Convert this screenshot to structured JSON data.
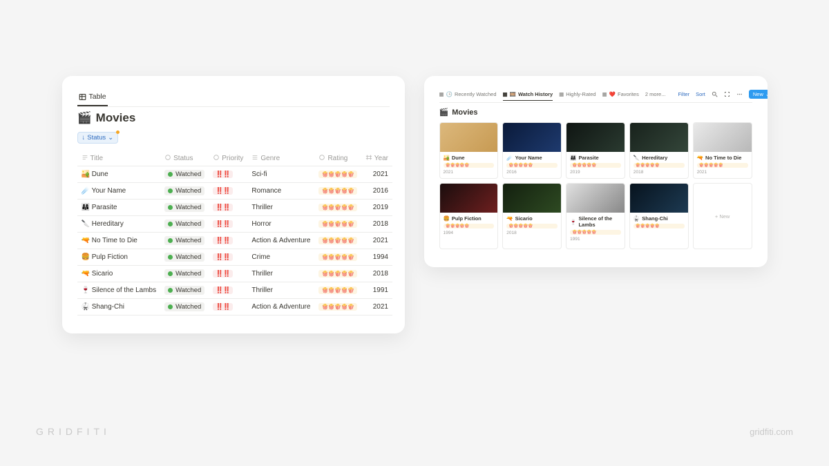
{
  "branding": {
    "logo_text": "GRIDFITI",
    "site": "gridfiti.com"
  },
  "left": {
    "view_tab": "Table",
    "title": "Movies",
    "title_emoji": "🎬",
    "filter_chip": {
      "arrow": "↓",
      "label": "Status",
      "chevron": "⌄"
    },
    "columns": {
      "title": "Title",
      "status": "Status",
      "priority": "Priority",
      "genre": "Genre",
      "rating": "Rating",
      "year": "Year"
    },
    "rows": [
      {
        "emoji": "🏜️",
        "title": "Dune",
        "status": "Watched",
        "priority": "‼️‼️",
        "genre": "Sci-fi",
        "rating": "🍿🍿🍿🍿🍿",
        "year": "2021"
      },
      {
        "emoji": "☄️",
        "title": "Your Name",
        "status": "Watched",
        "priority": "‼️‼️",
        "genre": "Romance",
        "rating": "🍿🍿🍿🍿🍿",
        "year": "2016"
      },
      {
        "emoji": "👨‍👩‍👧",
        "title": "Parasite",
        "status": "Watched",
        "priority": "‼️‼️",
        "genre": "Thriller",
        "rating": "🍿🍿🍿🍿🍿",
        "year": "2019"
      },
      {
        "emoji": "🔪",
        "title": "Hereditary",
        "status": "Watched",
        "priority": "‼️‼️",
        "genre": "Horror",
        "rating": "🍿🍿🍿🍿🍿",
        "year": "2018"
      },
      {
        "emoji": "🔫",
        "title": "No Time to Die",
        "status": "Watched",
        "priority": "‼️‼️",
        "genre": "Action & Adventure",
        "rating": "🍿🍿🍿🍿🍿",
        "year": "2021"
      },
      {
        "emoji": "🍔",
        "title": "Pulp Fiction",
        "status": "Watched",
        "priority": "‼️‼️",
        "genre": "Crime",
        "rating": "🍿🍿🍿🍿🍿",
        "year": "1994"
      },
      {
        "emoji": "🔫",
        "title": "Sicario",
        "status": "Watched",
        "priority": "‼️‼️",
        "genre": "Thriller",
        "rating": "🍿🍿🍿🍿🍿",
        "year": "2018"
      },
      {
        "emoji": "🍷",
        "title": "Silence of the Lambs",
        "status": "Watched",
        "priority": "‼️‼️",
        "genre": "Thriller",
        "rating": "🍿🍿🍿🍿🍿",
        "year": "1991"
      },
      {
        "emoji": "🥋",
        "title": "Shang-Chi",
        "status": "Watched",
        "priority": "‼️‼️",
        "genre": "Action & Adventure",
        "rating": "🍿🍿🍿🍿🍿",
        "year": "2021"
      }
    ]
  },
  "right": {
    "toolbar": {
      "tab1": {
        "emoji": "🕒",
        "label": "Recently Watched"
      },
      "tab2": {
        "emoji": "🎞️",
        "label": "Watch History"
      },
      "tab3": {
        "label": "Highly-Rated"
      },
      "tab4": {
        "emoji": "❤️",
        "label": "Favorites"
      },
      "more": "2 more...",
      "filter": "Filter",
      "sort": "Sort",
      "new": "New"
    },
    "title": "Movies",
    "title_emoji": "🎬",
    "new_card_label": "+ New",
    "cards": [
      {
        "emoji": "🏜️",
        "title": "Dune",
        "rating": "🍿🍿🍿🍿🍿",
        "year": "2021",
        "grad": [
          "#dcb87c",
          "#c79a52"
        ]
      },
      {
        "emoji": "☄️",
        "title": "Your Name",
        "rating": "🍿🍿🍿🍿🍿",
        "year": "2016",
        "grad": [
          "#0a1a3a",
          "#1e3a6e"
        ]
      },
      {
        "emoji": "👨‍👩‍👧",
        "title": "Parasite",
        "rating": "🍿🍿🍿🍿🍿",
        "year": "2019",
        "grad": [
          "#0f1512",
          "#2a3a30"
        ]
      },
      {
        "emoji": "🔪",
        "title": "Hereditary",
        "rating": "🍿🍿🍿🍿🍿",
        "year": "2018",
        "grad": [
          "#18221c",
          "#34463a"
        ]
      },
      {
        "emoji": "🔫",
        "title": "No Time to Die",
        "rating": "🍿🍿🍿🍿🍿",
        "year": "2021",
        "grad": [
          "#e9e9e9",
          "#b8b8b8"
        ]
      },
      {
        "emoji": "🍔",
        "title": "Pulp Fiction",
        "rating": "🍿🍿🍿🍿🍿",
        "year": "1994",
        "grad": [
          "#1a0d0d",
          "#6e1f1f"
        ]
      },
      {
        "emoji": "🔫",
        "title": "Sicario",
        "rating": "🍿🍿🍿🍿🍿",
        "year": "2018",
        "grad": [
          "#13200f",
          "#2e4a22"
        ]
      },
      {
        "emoji": "🍷",
        "title": "Silence of the Lambs",
        "rating": "🍿🍿🍿🍿🍿",
        "year": "1991",
        "grad": [
          "#e0e0e0",
          "#888"
        ]
      },
      {
        "emoji": "🥋",
        "title": "Shang-Chi",
        "rating": "🍿🍿🍿🍿🍿",
        "year": "",
        "grad": [
          "#07131e",
          "#1d3a52"
        ]
      }
    ]
  }
}
